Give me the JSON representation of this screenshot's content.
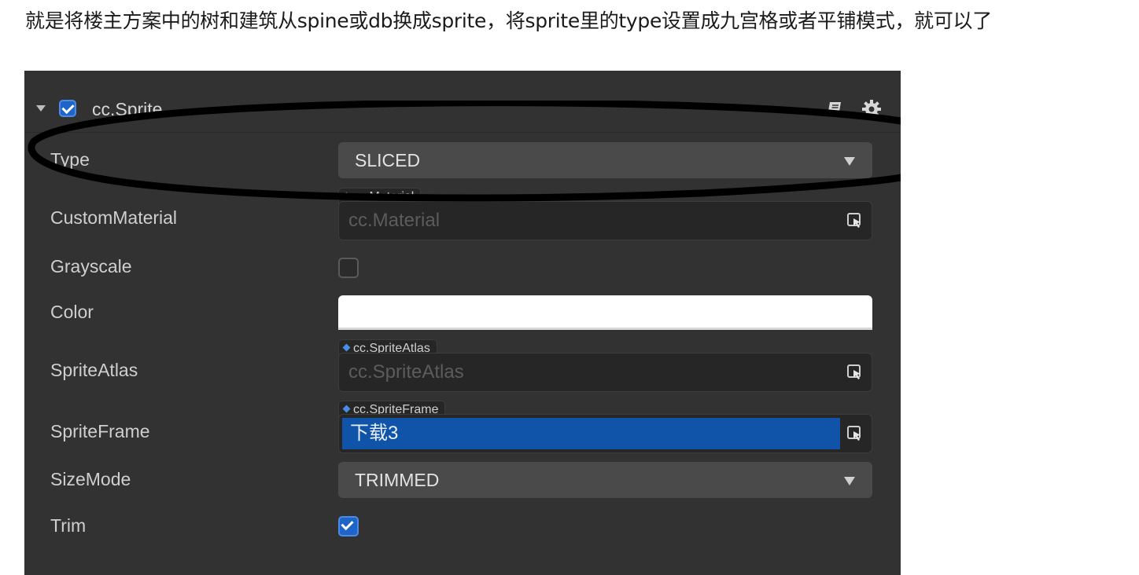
{
  "intro_text": "就是将楼主方案中的树和建筑从spine或db换成sprite，将sprite里的type设置成九宫格或者平铺模式，就可以了",
  "component": {
    "title": "cc.Sprite",
    "enabled": true
  },
  "header_icons": [
    "book-icon",
    "gear-icon"
  ],
  "properties": {
    "type": {
      "label": "Type",
      "value": "SLICED"
    },
    "custom_material": {
      "label": "CustomMaterial",
      "tag": "cc.Material",
      "placeholder": "cc.Material"
    },
    "grayscale": {
      "label": "Grayscale",
      "checked": false
    },
    "color": {
      "label": "Color",
      "value": "#FFFFFF"
    },
    "sprite_atlas": {
      "label": "SpriteAtlas",
      "tag": "cc.SpriteAtlas",
      "placeholder": "cc.SpriteAtlas"
    },
    "sprite_frame": {
      "label": "SpriteFrame",
      "tag": "cc.SpriteFrame",
      "value": "下载3"
    },
    "size_mode": {
      "label": "SizeMode",
      "value": "TRIMMED"
    },
    "trim": {
      "label": "Trim",
      "checked": true
    }
  },
  "colors": {
    "panel_bg": "#323232",
    "accent": "#1f64c8",
    "selection": "#0f54a8"
  }
}
